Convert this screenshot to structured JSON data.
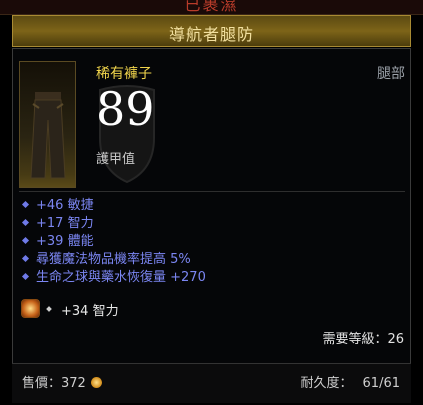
{
  "header": {
    "set_name": "已裹濕",
    "item_title": "導航者腿防"
  },
  "item": {
    "rarity_type": "稀有褲子",
    "slot": "腿部",
    "armor_value": "89",
    "armor_label": "護甲值"
  },
  "affixes": [
    {
      "text": "+46 敏捷"
    },
    {
      "text": "+17 智力"
    },
    {
      "text": "+39 體能"
    },
    {
      "text": "尋獲魔法物品機率提高 5%"
    },
    {
      "text": "生命之球與藥水恢復量 +270"
    }
  ],
  "socket": {
    "icon": "gem-icon",
    "text": "+34 智力"
  },
  "requirement": {
    "text": "需要等級：26"
  },
  "footer": {
    "sell_label": "售價：372",
    "durability_label": "耐久度：",
    "durability_value": "61/61"
  },
  "colors": {
    "rare_name": "#f1d54c",
    "magic_affix": "#7b86f2",
    "title_gold": "#f2e0a0"
  }
}
